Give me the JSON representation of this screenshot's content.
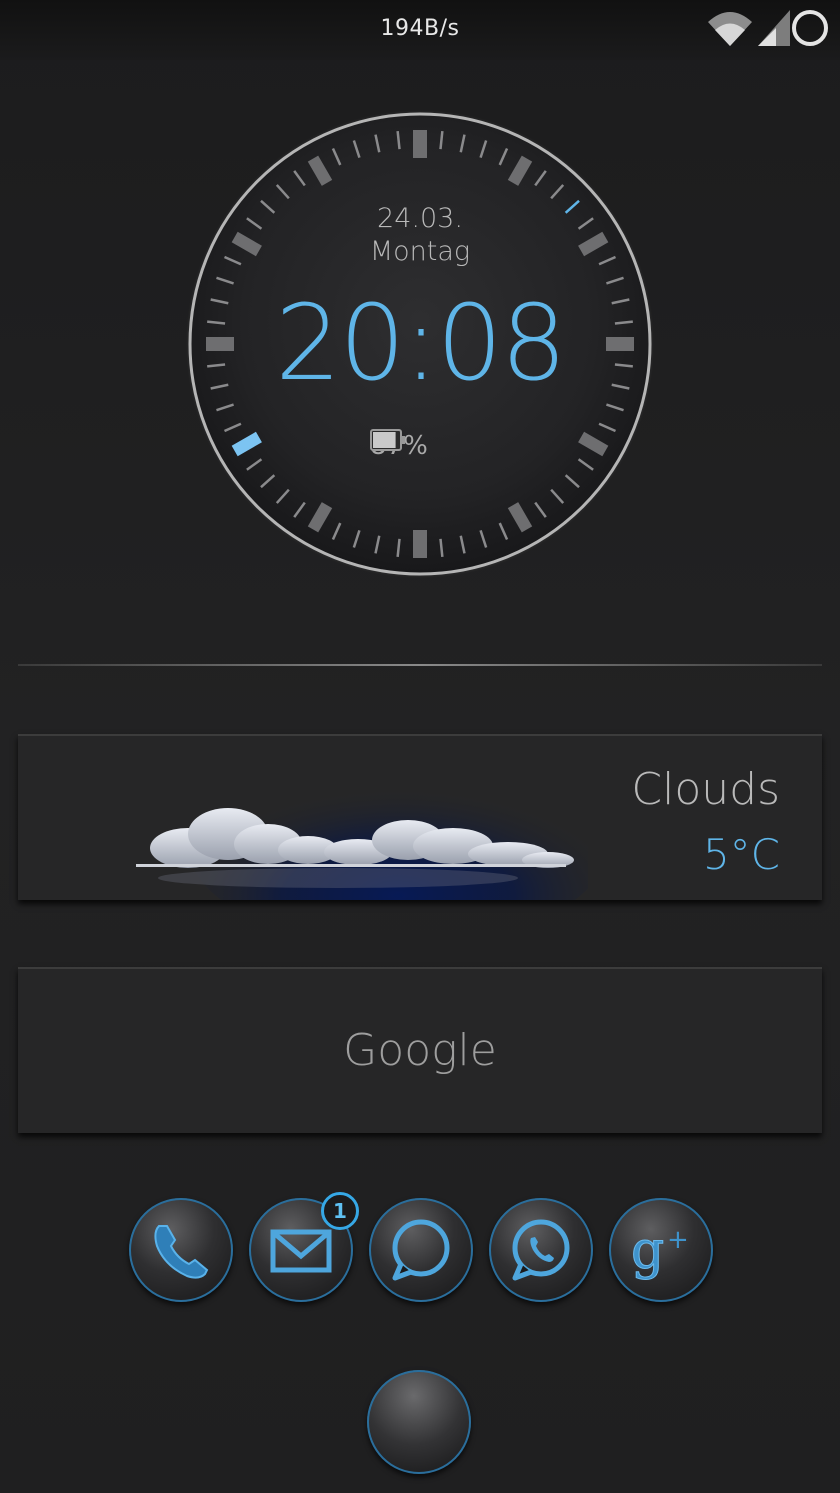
{
  "status_bar": {
    "net_speed": "194B/s",
    "icons": [
      "wifi-icon",
      "signal-icon",
      "battery-ring-icon"
    ]
  },
  "clock": {
    "date": "24.03.",
    "weekday": "Montag",
    "time": "20:08",
    "battery_percent": "87%",
    "battery_level": 0.87,
    "accent": "#5fb5e8"
  },
  "weather": {
    "condition": "Clouds",
    "temperature": "5°C",
    "icon": "clouds-icon"
  },
  "search": {
    "label": "Google"
  },
  "dock": {
    "apps": [
      {
        "icon": "phone-icon"
      },
      {
        "icon": "gmail-icon",
        "badge": "1"
      },
      {
        "icon": "messaging-icon"
      },
      {
        "icon": "whatsapp-icon"
      },
      {
        "icon": "google-plus-icon"
      }
    ],
    "home_icon": "app-drawer-icon"
  },
  "colors": {
    "background": "#1e1e1f",
    "accent_blue": "#5fb5e8",
    "panel": "#262627"
  }
}
